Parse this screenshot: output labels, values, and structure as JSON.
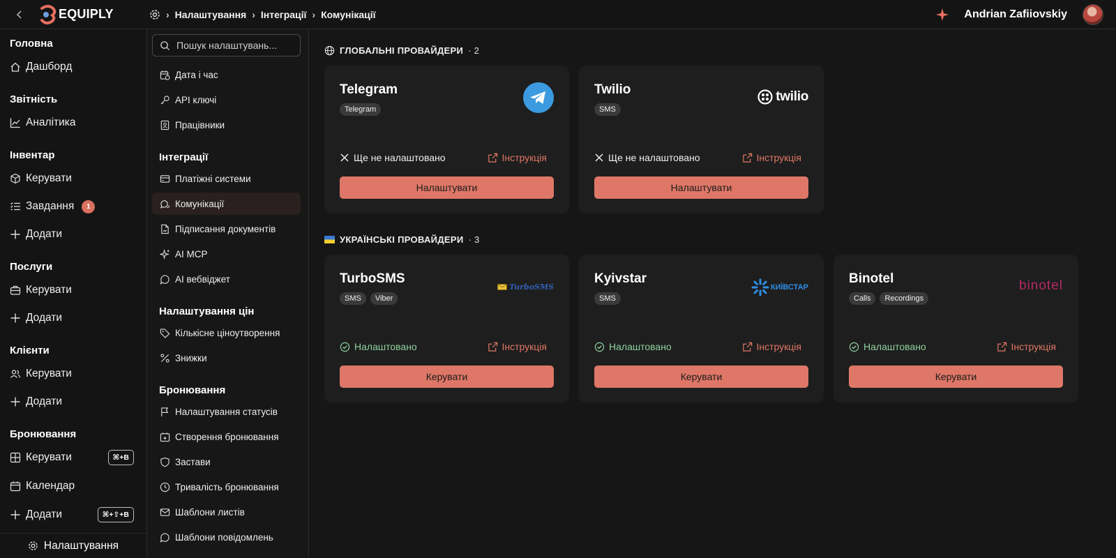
{
  "header": {
    "logo_text": "EQUIPLY",
    "breadcrumb": [
      "Налаштування",
      "Інтеграції",
      "Комунікації"
    ],
    "user_name": "Andrian Zafiiovskiy"
  },
  "sidebar": {
    "sections": [
      {
        "title": "Головна",
        "items": [
          {
            "label": "Дашборд",
            "icon": "home-icon"
          }
        ]
      },
      {
        "title": "Звітність",
        "items": [
          {
            "label": "Аналітика",
            "icon": "chart-line-icon"
          }
        ]
      },
      {
        "title": "Інвентар",
        "items": [
          {
            "label": "Керувати",
            "icon": "box-icon"
          },
          {
            "label": "Завдання",
            "icon": "task-list-icon",
            "badge": "1"
          },
          {
            "label": "Додати",
            "icon": "plus-icon"
          }
        ]
      },
      {
        "title": "Послуги",
        "items": [
          {
            "label": "Керувати",
            "icon": "briefcase-icon"
          },
          {
            "label": "Додати",
            "icon": "plus-icon"
          }
        ]
      },
      {
        "title": "Клієнти",
        "items": [
          {
            "label": "Керувати",
            "icon": "users-icon"
          },
          {
            "label": "Додати",
            "icon": "plus-icon"
          }
        ]
      },
      {
        "title": "Бронювання",
        "items": [
          {
            "label": "Керувати",
            "icon": "grid-icon",
            "shortcut": "⌘+B"
          },
          {
            "label": "Календар",
            "icon": "calendar-icon"
          },
          {
            "label": "Додати",
            "icon": "plus-icon",
            "shortcut": "⌘+⇧+B"
          }
        ]
      }
    ],
    "bottom_label": "Налаштування"
  },
  "settings_nav": {
    "search_placeholder": "Пошук налаштувань...",
    "top_items": [
      "Дата і час",
      "API ключі",
      "Працівники"
    ],
    "sections": [
      {
        "title": "Інтеграції",
        "items": [
          "Платіжні системи",
          "Комунікації",
          "Підписання документів",
          "AI MCP",
          "AI вебвіджет"
        ]
      },
      {
        "title": "Налаштування цін",
        "items": [
          "Кількісне ціноутворення",
          "Знижки"
        ]
      },
      {
        "title": "Бронювання",
        "items": [
          "Налаштування статусів",
          "Створення бронювання",
          "Застави",
          "Тривалість бронювання",
          "Шаблони листів",
          "Шаблони повідомлень"
        ]
      }
    ]
  },
  "main": {
    "global": {
      "title": "ГЛОБАЛЬНІ ПРОВАЙДЕРИ",
      "count": "· 2",
      "cards": [
        {
          "name": "Telegram",
          "tags": [
            "Telegram"
          ],
          "status": "Ще не налаштовано",
          "guide": "Інструкція",
          "button": "Налаштувати"
        },
        {
          "name": "Twilio",
          "tags": [
            "SMS"
          ],
          "brand": "twilio",
          "status": "Ще не налаштовано",
          "guide": "Інструкція",
          "button": "Налаштувати"
        }
      ]
    },
    "ukrainian": {
      "title": "УКРАЇНСЬКІ ПРОВАЙДЕРИ",
      "count": "· 3",
      "cards": [
        {
          "name": "TurboSMS",
          "tags": [
            "SMS",
            "Viber"
          ],
          "brand": "TurboSMS",
          "status": "Налаштовано",
          "guide": "Інструкція",
          "button": "Керувати"
        },
        {
          "name": "Kyivstar",
          "tags": [
            "SMS"
          ],
          "brand": "КИЇВСТАР",
          "status": "Налаштовано",
          "guide": "Інструкція",
          "button": "Керувати"
        },
        {
          "name": "Binotel",
          "tags": [
            "Calls",
            "Recordings"
          ],
          "brand": "binotel",
          "status": "Налаштовано",
          "guide": "Інструкція",
          "button": "Керувати"
        }
      ]
    }
  },
  "colors": {
    "accent": "#de7767",
    "success": "#8fd19e",
    "background": "#161616",
    "card": "#1e1e1e"
  }
}
